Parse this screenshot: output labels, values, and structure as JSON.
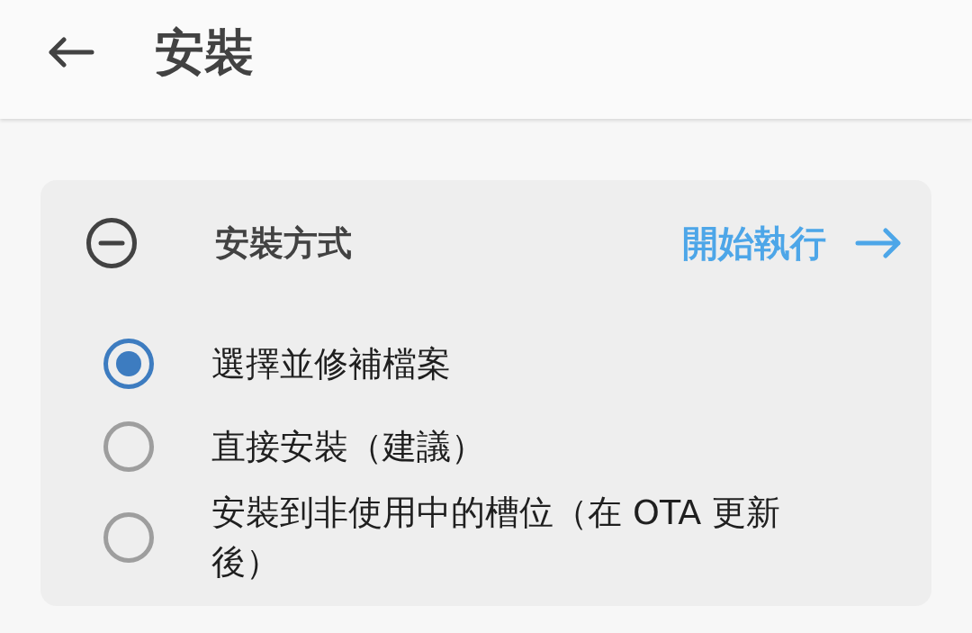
{
  "app_bar": {
    "title": "安裝"
  },
  "card": {
    "title": "安裝方式",
    "action": "開始執行",
    "options": [
      {
        "label": "選擇並修補檔案",
        "selected": true
      },
      {
        "label": "直接安裝（建議）",
        "selected": false
      },
      {
        "label": "安裝到非使用中的槽位（在 OTA 更新後）",
        "selected": false
      }
    ]
  }
}
